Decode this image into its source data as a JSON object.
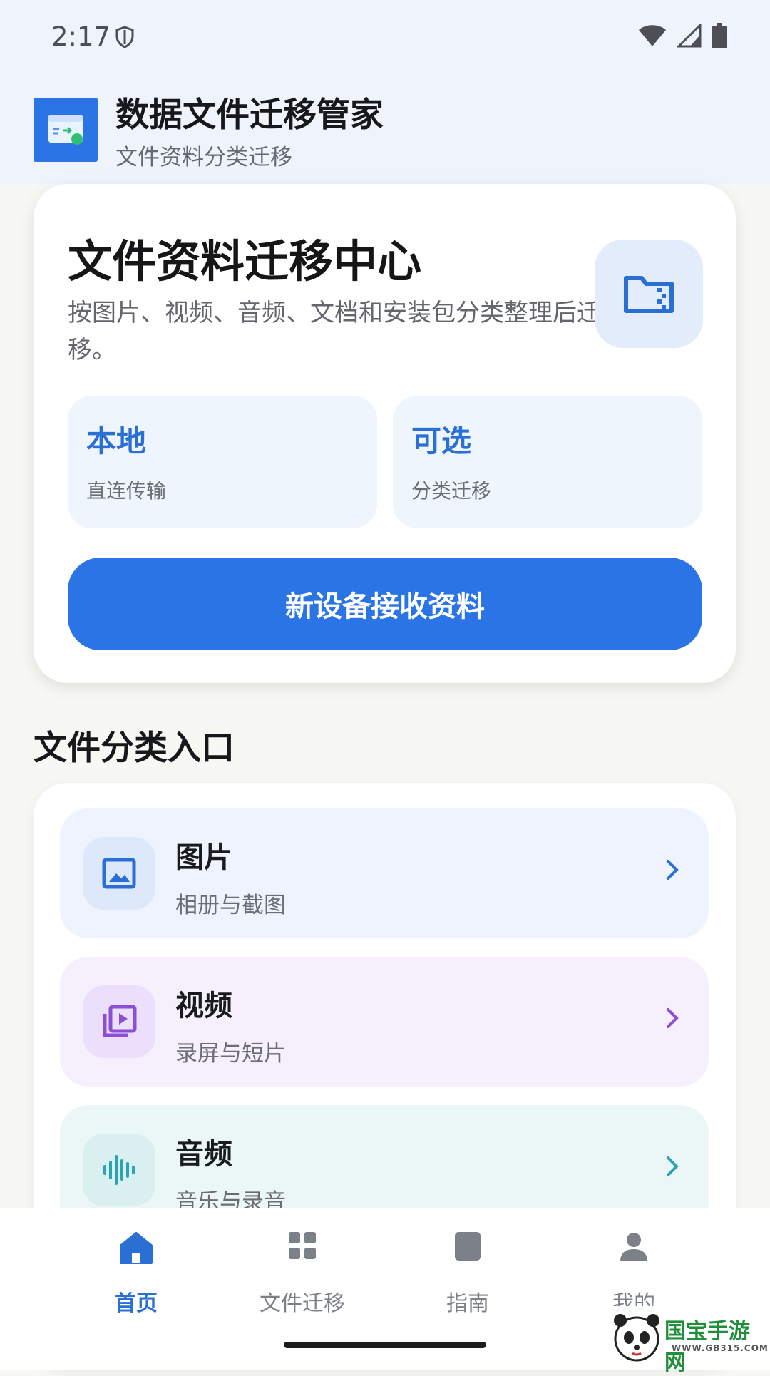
{
  "status_bar": {
    "time": "2:17"
  },
  "app": {
    "title": "数据文件迁移管家",
    "subtitle": "文件资料分类迁移"
  },
  "hero": {
    "title": "文件资料迁移中心",
    "description": "按图片、视频、音频、文档和安装包分类整理后迁移。",
    "stats": [
      {
        "value": "本地",
        "label": "直连传输"
      },
      {
        "value": "可选",
        "label": "分类迁移"
      }
    ],
    "primary_button": "新设备接收资料"
  },
  "section": {
    "title": "文件分类入口"
  },
  "categories": [
    {
      "name": "图片",
      "desc": "相册与截图",
      "bg": "#eef3fd",
      "icon_bg": "#dde8fa",
      "accent": "#2a6fd4",
      "icon": "image-icon"
    },
    {
      "name": "视频",
      "desc": "录屏与短片",
      "bg": "#f6f0fd",
      "icon_bg": "#ecdffb",
      "accent": "#8a4fd6",
      "icon": "video-library-icon"
    },
    {
      "name": "音频",
      "desc": "音乐与录音",
      "bg": "#ebf6f6",
      "icon_bg": "#d9eff0",
      "accent": "#2aa3b3",
      "icon": "audio-wave-icon"
    }
  ],
  "nav": [
    {
      "label": "首页",
      "icon": "home-icon",
      "active": true
    },
    {
      "label": "文件迁移",
      "icon": "grid-icon",
      "active": false
    },
    {
      "label": "指南",
      "icon": "book-icon",
      "active": false
    },
    {
      "label": "我的",
      "icon": "person-icon",
      "active": false
    }
  ],
  "watermark": {
    "text": "国宝手游网",
    "url": "WWW.GB315.COM"
  },
  "colors": {
    "primary": "#2a74e6",
    "header_bg": "#eff3fb",
    "page_bg": "#f7f7f3"
  }
}
